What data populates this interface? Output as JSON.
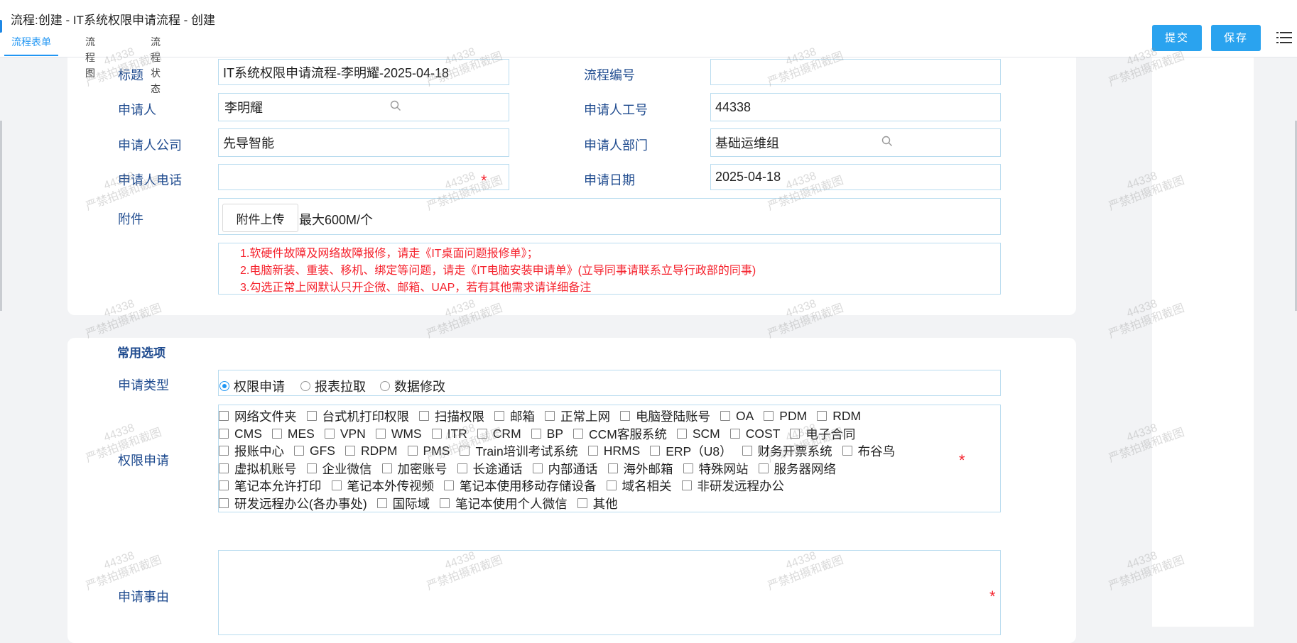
{
  "header": {
    "title": "流程:创建 - IT系统权限申请流程 - 创建",
    "tabs": [
      {
        "label": "流程表单",
        "active": true
      },
      {
        "label": "流程图",
        "active": false
      },
      {
        "label": "流程状态",
        "active": false
      }
    ],
    "submit_label": "提交",
    "save_label": "保存"
  },
  "form": {
    "title_label": "标题",
    "title_value": "IT系统权限申请流程-李明耀-2025-04-18",
    "flow_no_label": "流程编号",
    "flow_no_value": "",
    "applicant_label": "申请人",
    "applicant_value": "李明耀",
    "emp_no_label": "申请人工号",
    "emp_no_value": "44338",
    "company_label": "申请人公司",
    "company_value": "先导智能",
    "dept_label": "申请人部门",
    "dept_value": "基础运维组",
    "phone_label": "申请人电话",
    "phone_value": "",
    "date_label": "申请日期",
    "date_value": "2025-04-18",
    "attachment_label": "附件",
    "upload_label": "附件上传",
    "upload_hint": "最大600M/个",
    "notes": [
      "1.软硬件故障及网络故障报修，请走《IT桌面问题报修单》；",
      "2.电脑新装、重装、移机、绑定等问题，请走《IT电脑安装申请单》(立导同事请联系立导行政部的同事)",
      "3.勾选正常上网默认只开企微、邮箱、UAP，若有其他需求请详细备注"
    ],
    "required_mark": "*"
  },
  "common": {
    "section_title": "常用选项",
    "apply_type_label": "申请类型",
    "apply_types": [
      {
        "label": "权限申请",
        "checked": true
      },
      {
        "label": "报表拉取",
        "checked": false
      },
      {
        "label": "数据修改",
        "checked": false
      }
    ],
    "permission_label": "权限申请",
    "permission_rows": [
      [
        "网络文件夹",
        "台式机打印权限",
        "扫描权限",
        "邮箱",
        "正常上网",
        "电脑登陆账号",
        "OA",
        "PDM",
        "RDM"
      ],
      [
        "CMS",
        "MES",
        "VPN",
        "WMS",
        "ITR",
        "CRM",
        "BP",
        "CCM客服系统",
        "SCM",
        "COST",
        "电子合同"
      ],
      [
        "报账中心",
        "GFS",
        "RDPM",
        "PMS",
        "Train培训考试系统",
        "HRMS",
        "ERP（U8）",
        "财务开票系统",
        "布谷鸟"
      ],
      [
        "虚拟机账号",
        "企业微信",
        "加密账号",
        "长途通话",
        "内部通话",
        "海外邮箱",
        "特殊网站",
        "服务器网络"
      ],
      [
        "笔记本允许打印",
        "笔记本外传视频",
        "笔记本使用移动存储设备",
        "域名相关",
        "非研发远程办公"
      ],
      [
        "研发远程办公(各办事处)",
        "国际域",
        "笔记本使用个人微信",
        "其他"
      ]
    ],
    "reason_label": "申请事由",
    "reason_value": ""
  },
  "watermark": {
    "line1": "44338",
    "line2": "严禁拍摄和截图"
  },
  "colors": {
    "accent": "#2196f3",
    "button": "#2aa3ef",
    "label": "#1f4b8f",
    "required": "#f5222d",
    "field_border": "#b9dcef"
  }
}
